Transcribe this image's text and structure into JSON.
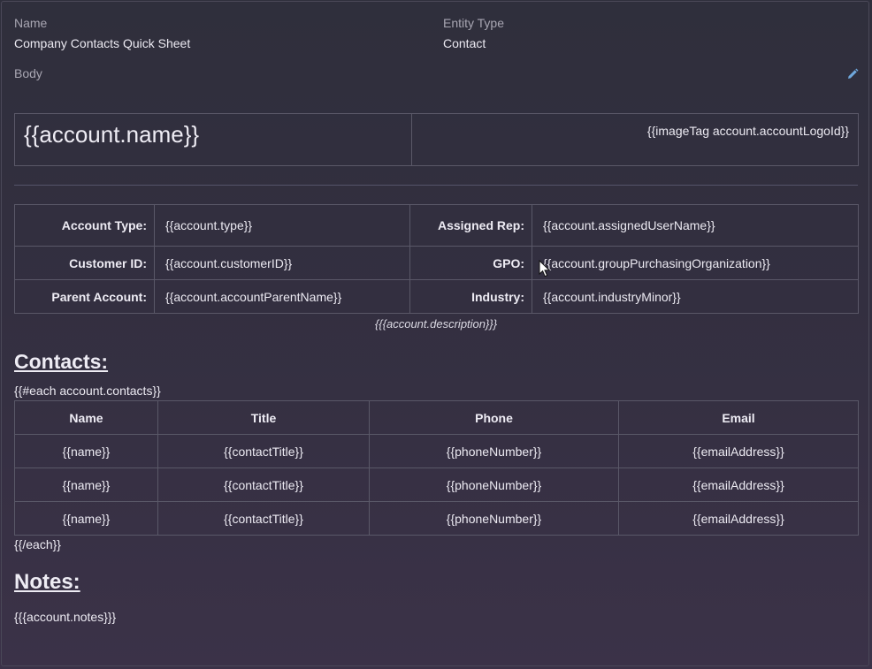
{
  "meta": {
    "name_label": "Name",
    "name_value": "Company Contacts Quick Sheet",
    "entity_type_label": "Entity Type",
    "entity_type_value": "Contact",
    "body_label": "Body"
  },
  "icons": {
    "edit": "pencil-icon",
    "cursor": "mouse-pointer-icon"
  },
  "header": {
    "account_name": "{{account.name}}",
    "logo_tag": "{{imageTag account.accountLogoId}}"
  },
  "info": {
    "rows": [
      {
        "label1": "Account Type:",
        "value1": "{{account.type}}",
        "label2": "Assigned Rep:",
        "value2": "{{account.assignedUserName}}"
      },
      {
        "label1": "Customer ID:",
        "value1": "{{account.customerID}}",
        "label2": "GPO:",
        "value2": "{{account.groupPurchasingOrganization}}"
      },
      {
        "label1": "Parent Account:",
        "value1": "{{account.accountParentName}}",
        "label2": "Industry:",
        "value2": "{{account.industryMinor}}"
      }
    ],
    "description": "{{{account.description}}}"
  },
  "contacts": {
    "title": "Contacts:",
    "each_open": "{{#each account.contacts}}",
    "each_close": "{{/each}}",
    "columns": [
      "Name",
      "Title",
      "Phone",
      "Email"
    ],
    "rows": [
      [
        "{{name}}",
        "{{contactTitle}}",
        "{{phoneNumber}}",
        "{{emailAddress}}"
      ],
      [
        "{{name}}",
        "{{contactTitle}}",
        "{{phoneNumber}}",
        "{{emailAddress}}"
      ],
      [
        "{{name}}",
        "{{contactTitle}}",
        "{{phoneNumber}}",
        "{{emailAddress}}"
      ]
    ]
  },
  "notes": {
    "title": "Notes:",
    "value": "{{{account.notes}}}"
  },
  "colors": {
    "background": "#332f40",
    "border": "#5a5868",
    "text": "#eceaf2",
    "muted": "#a8a6b2",
    "accent": "#6fa8dc"
  }
}
